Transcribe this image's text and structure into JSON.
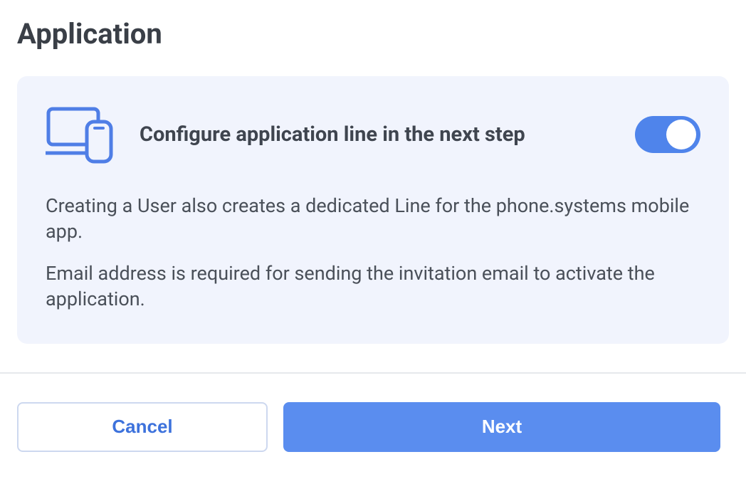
{
  "page": {
    "title": "Application"
  },
  "card": {
    "title": "Configure application line in the next step",
    "description1": "Creating a User also creates a dedicated Line for the phone.systems mobile app.",
    "description2": "Email address is required for sending the invitation email to activate the application.",
    "toggle_on": true
  },
  "actions": {
    "cancel_label": "Cancel",
    "next_label": "Next"
  },
  "colors": {
    "accent": "#4f84eb",
    "card_bg": "#f1f4fd"
  }
}
